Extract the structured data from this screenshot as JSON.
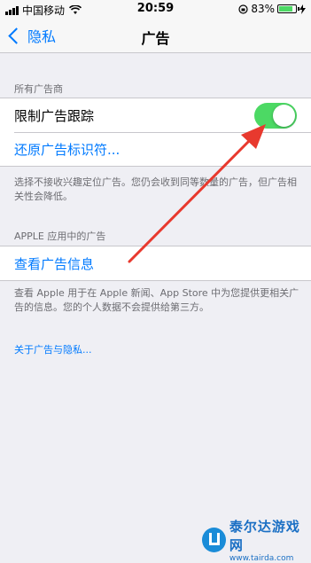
{
  "status_bar": {
    "carrier": "中国移动",
    "time": "20:59",
    "battery_percent": "83%",
    "battery_level": 0.83
  },
  "nav": {
    "back_label": "隐私",
    "title": "广告"
  },
  "section1": {
    "header": "所有广告商",
    "limit_tracking_label": "限制广告跟踪",
    "limit_tracking_on": true,
    "reset_label": "还原广告标识符...",
    "footer": "选择不接收兴趣定位广告。您仍会收到同等数量的广告，但广告相关性会降低。"
  },
  "section2": {
    "header": "APPLE 应用中的广告",
    "view_info_label": "查看广告信息",
    "footer": "查看 Apple 用于在 Apple 新闻、App Store 中为您提供更相关广告的信息。您的个人数据不会提供给第三方。"
  },
  "about_link": "关于广告与隐私...",
  "watermark": {
    "title": "泰尔达游戏网",
    "url": "www.tairda.com"
  },
  "colors": {
    "accent": "#007aff",
    "toggle_on": "#4cd964",
    "annotation_arrow": "#e8392e"
  },
  "icons": [
    "signal-icon",
    "wifi-icon",
    "lock-rotation-icon",
    "battery-icon",
    "charging-icon",
    "chevron-left-icon"
  ]
}
